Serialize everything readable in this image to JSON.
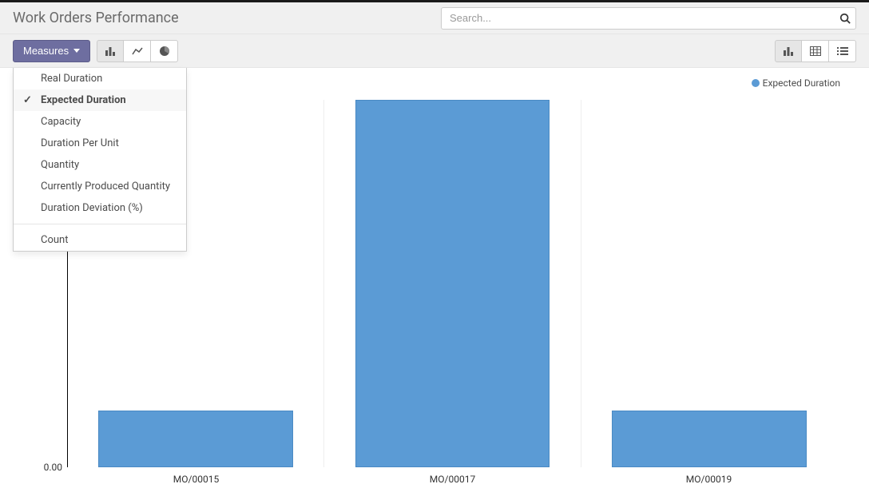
{
  "header": {
    "title": "Work Orders Performance",
    "search_placeholder": "Search..."
  },
  "toolbar": {
    "measures_label": "Measures",
    "chart_types": [
      "bar-chart",
      "line-chart",
      "pie-chart"
    ],
    "view_modes": [
      "graph",
      "pivot",
      "list"
    ]
  },
  "measures_dropdown": {
    "items": [
      {
        "label": "Real Duration",
        "selected": false
      },
      {
        "label": "Expected Duration",
        "selected": true
      },
      {
        "label": "Capacity",
        "selected": false
      },
      {
        "label": "Duration Per Unit",
        "selected": false
      },
      {
        "label": "Quantity",
        "selected": false
      },
      {
        "label": "Currently Produced Quantity",
        "selected": false
      },
      {
        "label": "Duration Deviation (%)",
        "selected": false
      }
    ],
    "count_label": "Count"
  },
  "legend": {
    "series_label": "Expected Duration"
  },
  "chart_data": {
    "type": "bar",
    "categories": [
      "MO/00015",
      "MO/00017",
      "MO/00019"
    ],
    "values": [
      8,
      52,
      8
    ],
    "series_name": "Expected Duration",
    "ylabel": "",
    "xlabel": "",
    "ylim": [
      0,
      52
    ],
    "y_ticks": [
      0.0
    ]
  },
  "y_tick_label": "0.00"
}
